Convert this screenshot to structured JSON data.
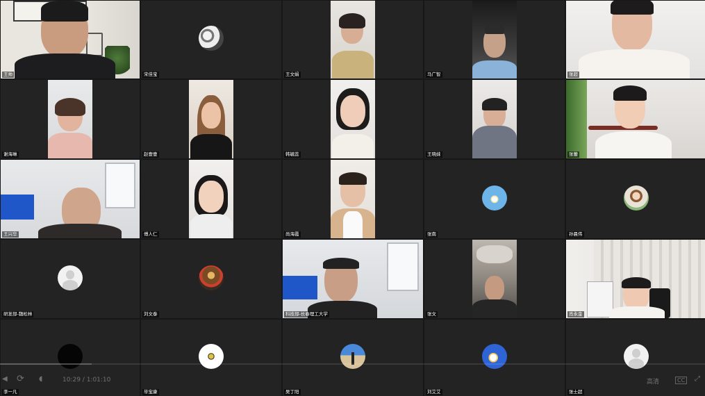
{
  "participants": [
    {
      "name": "王帅"
    },
    {
      "name": "宋佳宝"
    },
    {
      "name": "王文娟"
    },
    {
      "name": "马广智"
    },
    {
      "name": "张超"
    },
    {
      "name": "谢海琳"
    },
    {
      "name": "赵壹壹"
    },
    {
      "name": "韩毓蕊"
    },
    {
      "name": "王晓妹"
    },
    {
      "name": "张蕾"
    },
    {
      "name": "王兴华"
    },
    {
      "name": "傅人仁"
    },
    {
      "name": "尚海霞"
    },
    {
      "name": "张南"
    },
    {
      "name": "孙晨伟"
    },
    {
      "name": "研发部-魏松林"
    },
    {
      "name": "刘文泰"
    },
    {
      "name": "科技部-长春理工大学"
    },
    {
      "name": "张文"
    },
    {
      "name": "肖永金"
    },
    {
      "name": "李一凡"
    },
    {
      "name": "毕宝康"
    },
    {
      "name": "吴丁阳"
    },
    {
      "name": "刘艾艾"
    },
    {
      "name": "张士超"
    }
  ],
  "player": {
    "time": "10:29 / 1:01:10",
    "quality": "高清",
    "cc": "CC"
  },
  "icons": [
    "play-icon",
    "skip-icon",
    "volume-icon",
    "fullscreen-icon"
  ]
}
